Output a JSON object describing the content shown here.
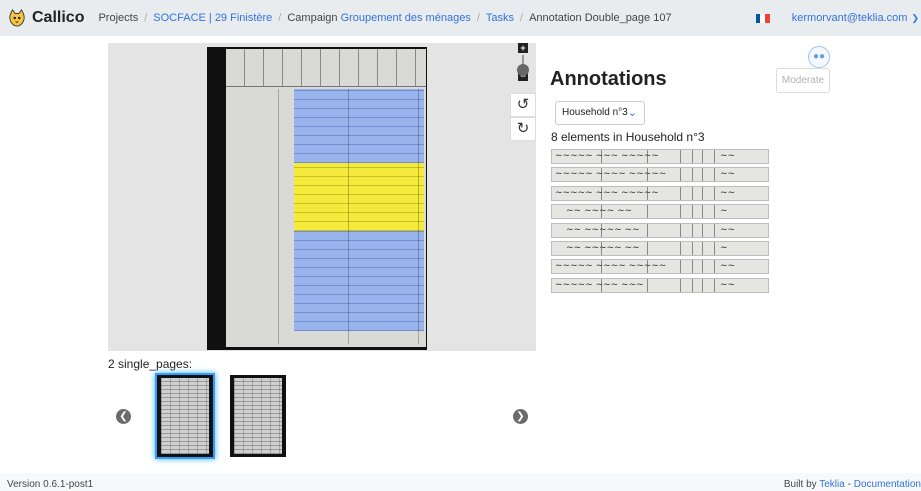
{
  "navbar": {
    "brand": "Callico",
    "breadcrumbs": {
      "projects": "Projects",
      "project": "SOCFACE | 29 Finistère",
      "campaign_prefix": "Campaign",
      "campaign": "Groupement des ménages",
      "tasks": "Tasks",
      "current": "Annotation Double_page 107",
      "separator": "/"
    },
    "user": "kermorvant@teklia.com",
    "flag_colors": [
      "#0055a4",
      "#ffffff",
      "#ef4135"
    ]
  },
  "viewer": {
    "zoom_in": "+",
    "zoom_out": "−",
    "rotate_left": "↺",
    "rotate_right": "↻",
    "highlight_colors": {
      "blue": "#6496ff",
      "yellow": "#fff000"
    }
  },
  "single_pages": {
    "label": "2 single_pages:",
    "prev_icon": "❮",
    "next_icon": "❯",
    "active_index": 0,
    "count": 2
  },
  "annotations": {
    "title": "Annotations",
    "moderate": "Moderate",
    "avatar_icon": "user-group-icon",
    "household_select": "Household n°3",
    "elements_count": "8 elements in Household n°3"
  },
  "footer": {
    "version": "Version 0.6.1-post1",
    "built_by": "Built by",
    "teklia": "Teklia",
    "dash": "-",
    "documentation": "Documentation"
  }
}
